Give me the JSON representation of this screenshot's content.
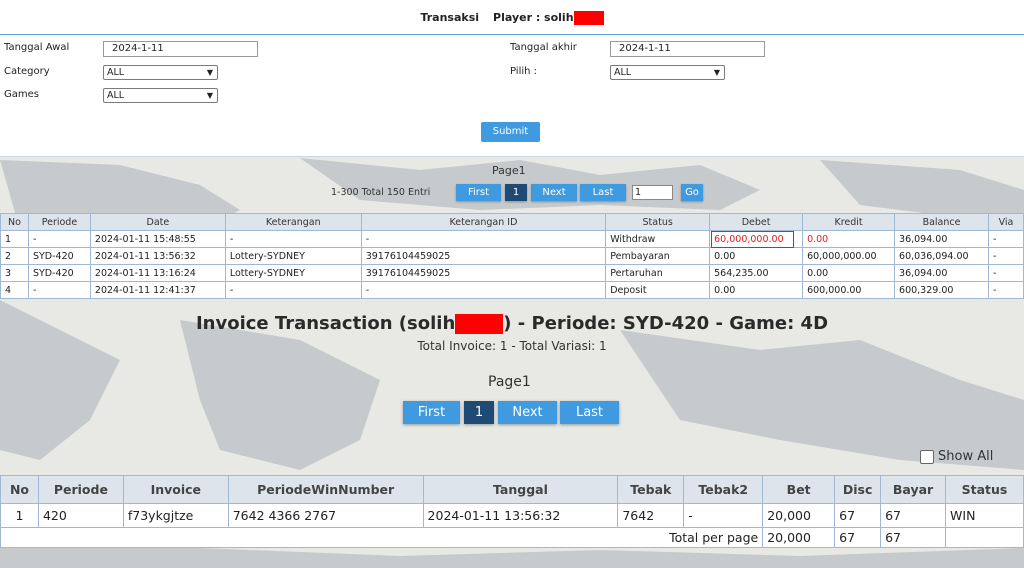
{
  "header": {
    "title": "Transaksi",
    "player_label": "Player : solih"
  },
  "form": {
    "tanggal_awal_label": "Tanggal Awal",
    "tanggal_awal_value": "2024-1-11",
    "tanggal_akhir_label": "Tanggal akhir",
    "tanggal_akhir_value": "2024-1-11",
    "category_label": "Category",
    "category_value": "ALL",
    "pilih_label": "Pilih  :",
    "pilih_value": "ALL",
    "games_label": "Games",
    "games_value": "ALL",
    "submit_label": "Submit"
  },
  "pager_small": {
    "page_label": "Page1",
    "entri_text": "1-300 Total 150 Entri",
    "first": "First",
    "current": "1",
    "next": "Next",
    "last": "Last",
    "goto_value": "1",
    "go": "Go"
  },
  "tx_table": {
    "headers": [
      "No",
      "Periode",
      "Date",
      "Keterangan",
      "Keterangan ID",
      "Status",
      "Debet",
      "Kredit",
      "Balance",
      "Via"
    ],
    "rows": [
      [
        "1",
        "-",
        "2024-01-11 15:48:55",
        "-",
        "-",
        "Withdraw",
        "60,000,000.00",
        "0.00",
        "36,094.00",
        "-"
      ],
      [
        "2",
        "SYD-420",
        "2024-01-11 13:56:32",
        "Lottery-SYDNEY",
        "39176104459025",
        "Pembayaran",
        "0.00",
        "60,000,000.00",
        "60,036,094.00",
        "-"
      ],
      [
        "3",
        "SYD-420",
        "2024-01-11 13:16:24",
        "Lottery-SYDNEY",
        "39176104459025",
        "Pertaruhan",
        "564,235.00",
        "0.00",
        "36,094.00",
        "-"
      ],
      [
        "4",
        "-",
        "2024-01-11 12:41:37",
        "-",
        "-",
        "Deposit",
        "0.00",
        "600,000.00",
        "600,329.00",
        "-"
      ]
    ]
  },
  "invoice": {
    "title_prefix": "Invoice Transaction (solih",
    "title_suffix": ") - Periode: SYD-420 - Game: 4D",
    "subtitle": "Total Invoice: 1 - Total Variasi: 1",
    "page_label": "Page1",
    "first": "First",
    "current": "1",
    "next": "Next",
    "last": "Last",
    "show_all": "Show All"
  },
  "inv_table": {
    "headers": [
      "No",
      "Periode",
      "Invoice",
      "PeriodeWinNumber",
      "Tanggal",
      "Tebak",
      "Tebak2",
      "Bet",
      "Disc",
      "Bayar",
      "Status"
    ],
    "row": [
      "1",
      "420",
      "f73ykgjtze",
      "7642 4366 2767",
      "2024-01-11 13:56:32",
      "7642",
      "-",
      "20,000",
      "67",
      "67",
      "WIN"
    ],
    "total_label": "Total per page",
    "total_bet": "20,000",
    "total_disc": "67",
    "total_bayar": "67"
  },
  "colors": {
    "accent": "#3f9ae0",
    "active_page": "#1e4a73",
    "redaction": "#ff0000",
    "highlight": "#e02020"
  }
}
